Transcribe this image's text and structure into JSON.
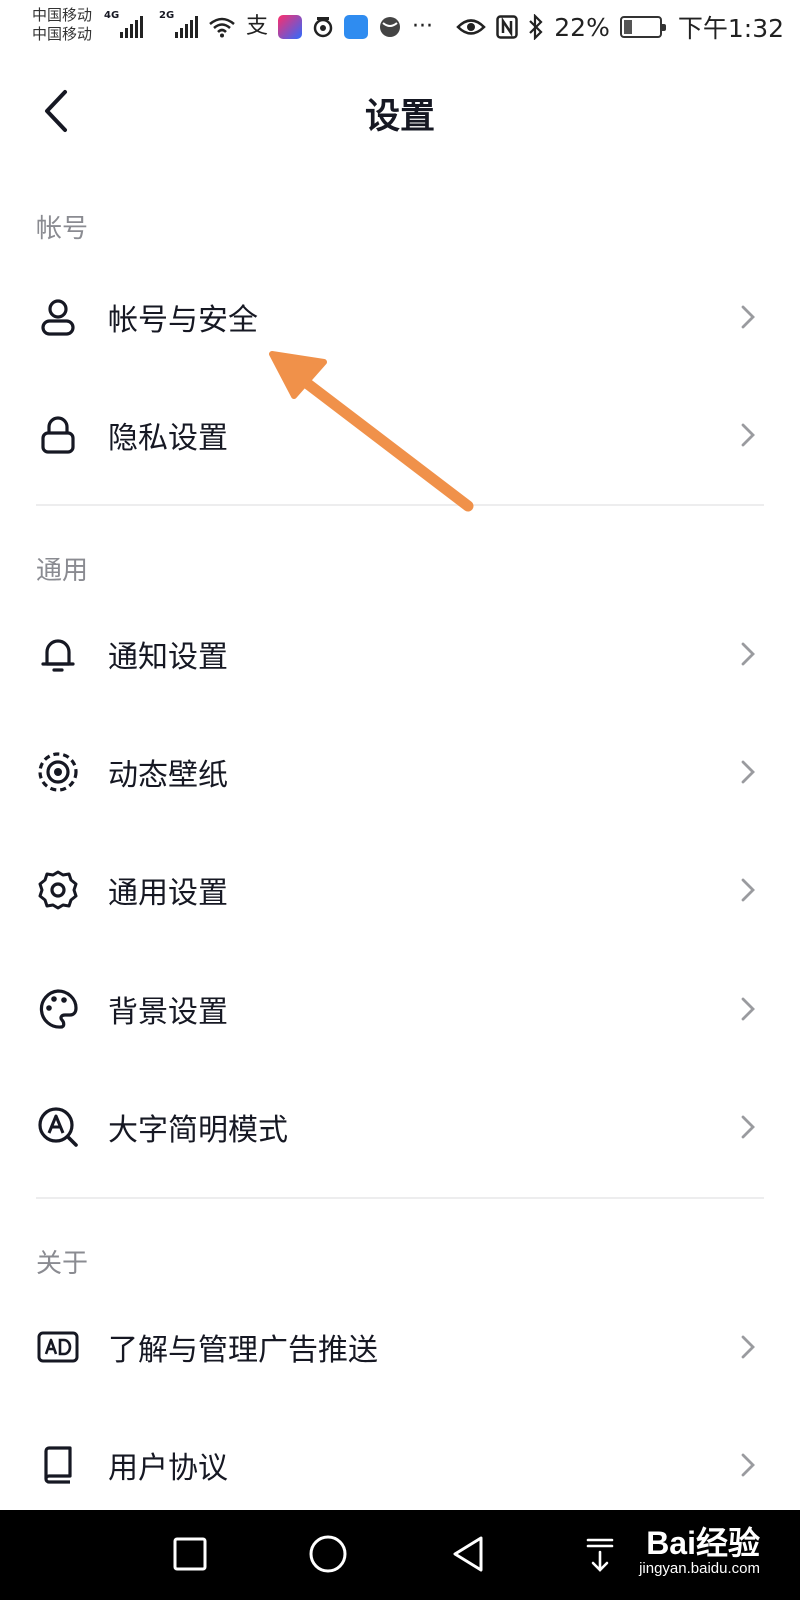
{
  "status_bar": {
    "carrier_1": "中国移动",
    "carrier_2": "中国移动",
    "net_1": "4G",
    "net_2": "2G",
    "battery": "22%",
    "time": "下午1:32"
  },
  "header": {
    "title": "设置"
  },
  "sections": {
    "account": {
      "label": "帐号",
      "items": [
        {
          "label": "帐号与安全",
          "icon": "user-icon"
        },
        {
          "label": "隐私设置",
          "icon": "lock-icon"
        }
      ]
    },
    "general": {
      "label": "通用",
      "items": [
        {
          "label": "通知设置",
          "icon": "bell-icon"
        },
        {
          "label": "动态壁纸",
          "icon": "live-wallpaper-icon"
        },
        {
          "label": "通用设置",
          "icon": "gear-icon"
        },
        {
          "label": "背景设置",
          "icon": "palette-icon"
        },
        {
          "label": "大字简明模式",
          "icon": "large-text-icon"
        }
      ]
    },
    "about": {
      "label": "关于",
      "items": [
        {
          "label": "了解与管理广告推送",
          "icon": "ad-icon"
        },
        {
          "label": "用户协议",
          "icon": "book-icon"
        }
      ]
    }
  },
  "colors": {
    "accent_arrow": "#f0914a",
    "text_primary": "#161823",
    "text_secondary": "#8a8b91"
  },
  "watermark": {
    "brand": "Bai经验",
    "url": "jingyan.baidu.com"
  }
}
